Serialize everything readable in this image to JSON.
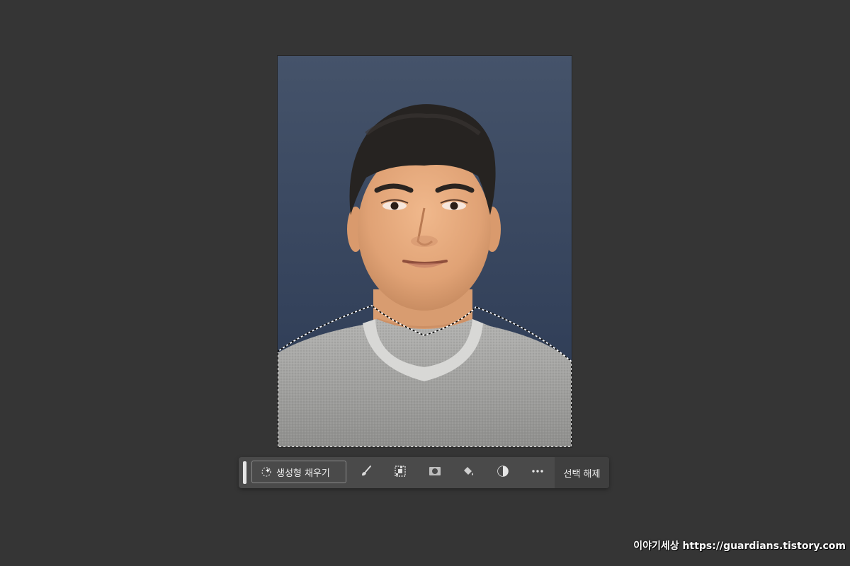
{
  "context_bar": {
    "generative_fill_label": "생성형 채우기",
    "deselect_label": "선택 해제",
    "tools": [
      {
        "name": "brush-icon"
      },
      {
        "name": "modify-selection-icon"
      },
      {
        "name": "mask-icon"
      },
      {
        "name": "fill-bucket-icon"
      },
      {
        "name": "adjustment-icon"
      },
      {
        "name": "more-icon"
      }
    ]
  },
  "watermark": {
    "text": "이야기세상 https://guardians.tistory.com"
  },
  "colors": {
    "workspace": "#353535",
    "toolbar": "#4a4a4a",
    "photo_background": "#3c4a62",
    "shirt": "#9b9b9b",
    "skin": "#e0a57a",
    "hair": "#262321"
  }
}
